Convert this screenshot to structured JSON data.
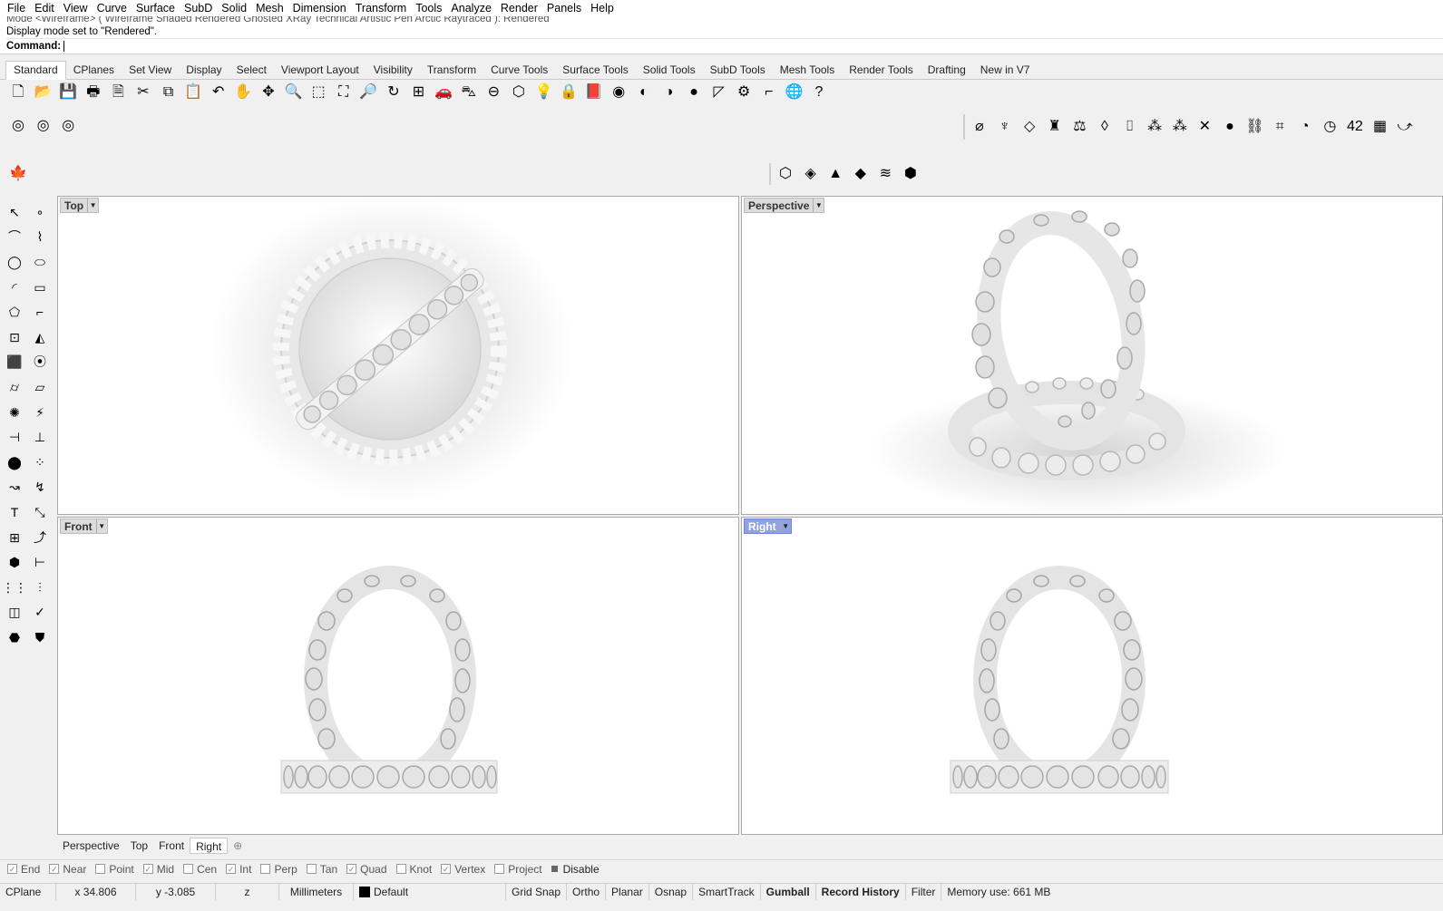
{
  "menu": [
    "File",
    "Edit",
    "View",
    "Curve",
    "Surface",
    "SubD",
    "Solid",
    "Mesh",
    "Dimension",
    "Transform",
    "Tools",
    "Analyze",
    "Render",
    "Panels",
    "Help"
  ],
  "command": {
    "history_line_1": "Mode <Wireframe> ( Wireframe  Shaded  Rendered  Ghosted  XRay  Technical  Artistic  Pen  Arctic  Raytraced ): Rendered",
    "history_line_2": "Display mode set to \"Rendered\".",
    "prompt_label": "Command:",
    "input_value": ""
  },
  "tabs": [
    "Standard",
    "CPlanes",
    "Set View",
    "Display",
    "Select",
    "Viewport Layout",
    "Visibility",
    "Transform",
    "Curve Tools",
    "Surface Tools",
    "Solid Tools",
    "SubD Tools",
    "Mesh Tools",
    "Render Tools",
    "Drafting",
    "New in V7"
  ],
  "active_tab": "Standard",
  "standard_toolbar": [
    {
      "name": "new-icon",
      "glyph": "🗋"
    },
    {
      "name": "open-icon",
      "glyph": "📂"
    },
    {
      "name": "save-icon",
      "glyph": "💾"
    },
    {
      "name": "print-icon",
      "glyph": "🖶"
    },
    {
      "name": "import-icon",
      "glyph": "🗎"
    },
    {
      "name": "cut-icon",
      "glyph": "✂"
    },
    {
      "name": "copy-icon",
      "glyph": "⧉"
    },
    {
      "name": "paste-icon",
      "glyph": "📋"
    },
    {
      "name": "undo-icon",
      "glyph": "↶"
    },
    {
      "name": "pan-icon",
      "glyph": "✋"
    },
    {
      "name": "rotate-view-icon",
      "glyph": "✥"
    },
    {
      "name": "zoom-icon",
      "glyph": "🔍"
    },
    {
      "name": "zoom-window-icon",
      "glyph": "⬚"
    },
    {
      "name": "zoom-extents-icon",
      "glyph": "⛶"
    },
    {
      "name": "zoom-selected-icon",
      "glyph": "🔎"
    },
    {
      "name": "undo-view-icon",
      "glyph": "↻"
    },
    {
      "name": "four-view-icon",
      "glyph": "⊞"
    },
    {
      "name": "car-icon",
      "glyph": "🚗"
    },
    {
      "name": "named-view-icon",
      "glyph": "⛍"
    },
    {
      "name": "cplane-icon",
      "glyph": "⊖"
    },
    {
      "name": "select-icon",
      "glyph": "⬡"
    },
    {
      "name": "light-icon",
      "glyph": "💡"
    },
    {
      "name": "lock-icon",
      "glyph": "🔒"
    },
    {
      "name": "layer-icon",
      "glyph": "📕"
    },
    {
      "name": "color-wheel-icon",
      "glyph": "◉"
    },
    {
      "name": "shaded-icon",
      "glyph": "◐"
    },
    {
      "name": "rendered-icon",
      "glyph": "◑"
    },
    {
      "name": "render-sphere-icon",
      "glyph": "●"
    },
    {
      "name": "dimension-icon",
      "glyph": "◸"
    },
    {
      "name": "options-icon",
      "glyph": "⚙"
    },
    {
      "name": "grid-snap-icon",
      "glyph": "⌐"
    },
    {
      "name": "globe-icon",
      "glyph": "🌐"
    },
    {
      "name": "help-icon",
      "glyph": "?"
    }
  ],
  "render_toolbar": [
    {
      "name": "render-icon",
      "glyph": "◎"
    },
    {
      "name": "render-preview-icon",
      "glyph": "◎"
    },
    {
      "name": "render-window-icon",
      "glyph": "◎"
    }
  ],
  "jewelry_toolbar": [
    {
      "name": "ring-icon",
      "glyph": "⌀"
    },
    {
      "name": "bezel-icon",
      "glyph": "♆"
    },
    {
      "name": "gem-icon",
      "glyph": "◇"
    },
    {
      "name": "prong-icon",
      "glyph": "♜"
    },
    {
      "name": "scale-icon",
      "glyph": "⚖"
    },
    {
      "name": "measure-icon",
      "glyph": "◊"
    },
    {
      "name": "ruler-icon",
      "glyph": "⌷"
    },
    {
      "name": "cluster-icon",
      "glyph": "⁂"
    },
    {
      "name": "stones-icon",
      "glyph": "⁂"
    },
    {
      "name": "scatter-icon",
      "glyph": "✕"
    },
    {
      "name": "gold-icon",
      "glyph": "●"
    },
    {
      "name": "chain-icon",
      "glyph": "⛓"
    },
    {
      "name": "text-curve-icon",
      "glyph": "⌗"
    },
    {
      "name": "circle-red-icon",
      "glyph": "◔"
    },
    {
      "name": "gauge-icon",
      "glyph": "◷"
    },
    {
      "name": "number-icon",
      "glyph": "42"
    },
    {
      "name": "grid-icon",
      "glyph": "▦"
    },
    {
      "name": "curve-icon",
      "glyph": "⤻"
    }
  ],
  "leaf_toolbar": [
    {
      "name": "leaf-icon",
      "glyph": "🍁"
    }
  ],
  "solid_toolbar": [
    {
      "name": "polyhedron-icon",
      "glyph": "⬡"
    },
    {
      "name": "octahedron-icon",
      "glyph": "◈"
    },
    {
      "name": "pyramid-icon",
      "glyph": "▲"
    },
    {
      "name": "diamond-icon",
      "glyph": "◆"
    },
    {
      "name": "wave-icon",
      "glyph": "≋"
    },
    {
      "name": "cage-icon",
      "glyph": "⬢"
    }
  ],
  "left_toolbox": [
    [
      {
        "name": "select-arrow-icon",
        "glyph": "↖"
      },
      {
        "name": "point-icon",
        "glyph": "∘"
      }
    ],
    [
      {
        "name": "polyline-icon",
        "glyph": "⌒"
      },
      {
        "name": "control-curve-icon",
        "glyph": "⌇"
      }
    ],
    [
      {
        "name": "circle-icon",
        "glyph": "◯"
      },
      {
        "name": "ellipse-icon",
        "glyph": "⬭"
      }
    ],
    [
      {
        "name": "arc-icon",
        "glyph": "◜"
      },
      {
        "name": "rectangle-icon",
        "glyph": "▭"
      }
    ],
    [
      {
        "name": "polygon-icon",
        "glyph": "⬠"
      },
      {
        "name": "fillet-curve-icon",
        "glyph": "⌐"
      }
    ],
    [
      {
        "name": "surface-points-icon",
        "glyph": "⊡"
      },
      {
        "name": "extrude-surface-icon",
        "glyph": "◭"
      }
    ],
    [
      {
        "name": "box-icon",
        "glyph": "⬛"
      },
      {
        "name": "boolean-union-icon",
        "glyph": "⦿"
      }
    ],
    [
      {
        "name": "cylinder-icon",
        "glyph": "⌭"
      },
      {
        "name": "mesh-plane-icon",
        "glyph": "▱"
      }
    ],
    [
      {
        "name": "explode-icon",
        "glyph": "✺"
      },
      {
        "name": "split-icon",
        "glyph": "⚡"
      }
    ],
    [
      {
        "name": "trim-icon",
        "glyph": "⊣"
      },
      {
        "name": "extend-icon",
        "glyph": "⊥"
      }
    ],
    [
      {
        "name": "group-icon",
        "glyph": "⬤"
      },
      {
        "name": "ungroup-icon",
        "glyph": "⁘"
      }
    ],
    [
      {
        "name": "blend-curve-icon",
        "glyph": "↝"
      },
      {
        "name": "offset-icon",
        "glyph": "↯"
      }
    ],
    [
      {
        "name": "text-icon",
        "glyph": "T"
      },
      {
        "name": "scale-tool-icon",
        "glyph": "⤡"
      }
    ],
    [
      {
        "name": "array-icon",
        "glyph": "⊞"
      },
      {
        "name": "orient-icon",
        "glyph": "⤴"
      }
    ],
    [
      {
        "name": "block-icon",
        "glyph": "⬢"
      },
      {
        "name": "dimension-tool-icon",
        "glyph": "⊢"
      }
    ],
    [
      {
        "name": "array-grid-icon",
        "glyph": "⋮⋮"
      },
      {
        "name": "align-icon",
        "glyph": "⫶"
      }
    ],
    [
      {
        "name": "clipping-icon",
        "glyph": "◫"
      },
      {
        "name": "check-icon",
        "glyph": "✓"
      }
    ],
    [
      {
        "name": "analyze-icon",
        "glyph": "⬣"
      },
      {
        "name": "paint-icon",
        "glyph": "⛊"
      }
    ]
  ],
  "viewports": {
    "top": {
      "label": "Top"
    },
    "perspective": {
      "label": "Perspective"
    },
    "front": {
      "label": "Front"
    },
    "right": {
      "label": "Right"
    }
  },
  "viewport_tabs": [
    "Perspective",
    "Top",
    "Front",
    "Right"
  ],
  "active_viewport_tab": "Right",
  "osnaps": [
    {
      "label": "End",
      "checked": true
    },
    {
      "label": "Near",
      "checked": true
    },
    {
      "label": "Point",
      "checked": false
    },
    {
      "label": "Mid",
      "checked": true
    },
    {
      "label": "Cen",
      "checked": false
    },
    {
      "label": "Int",
      "checked": true
    },
    {
      "label": "Perp",
      "checked": false
    },
    {
      "label": "Tan",
      "checked": false
    },
    {
      "label": "Quad",
      "checked": true
    },
    {
      "label": "Knot",
      "checked": false
    },
    {
      "label": "Vertex",
      "checked": true
    },
    {
      "label": "Project",
      "checked": false
    }
  ],
  "osnap_disable_label": "Disable",
  "status": {
    "cplane": "CPlane",
    "x": "x 34.806",
    "y": "y -3.085",
    "z": "z",
    "units": "Millimeters",
    "layer": "Default",
    "grid_snap": "Grid Snap",
    "ortho": "Ortho",
    "planar": "Planar",
    "osnap": "Osnap",
    "smarttrack": "SmartTrack",
    "gumball": "Gumball",
    "record_history": "Record History",
    "filter": "Filter",
    "memory": "Memory use: 661 MB"
  },
  "colors": {
    "active_viewport": "#8fa3e3",
    "layer_swatch": "#000000"
  }
}
